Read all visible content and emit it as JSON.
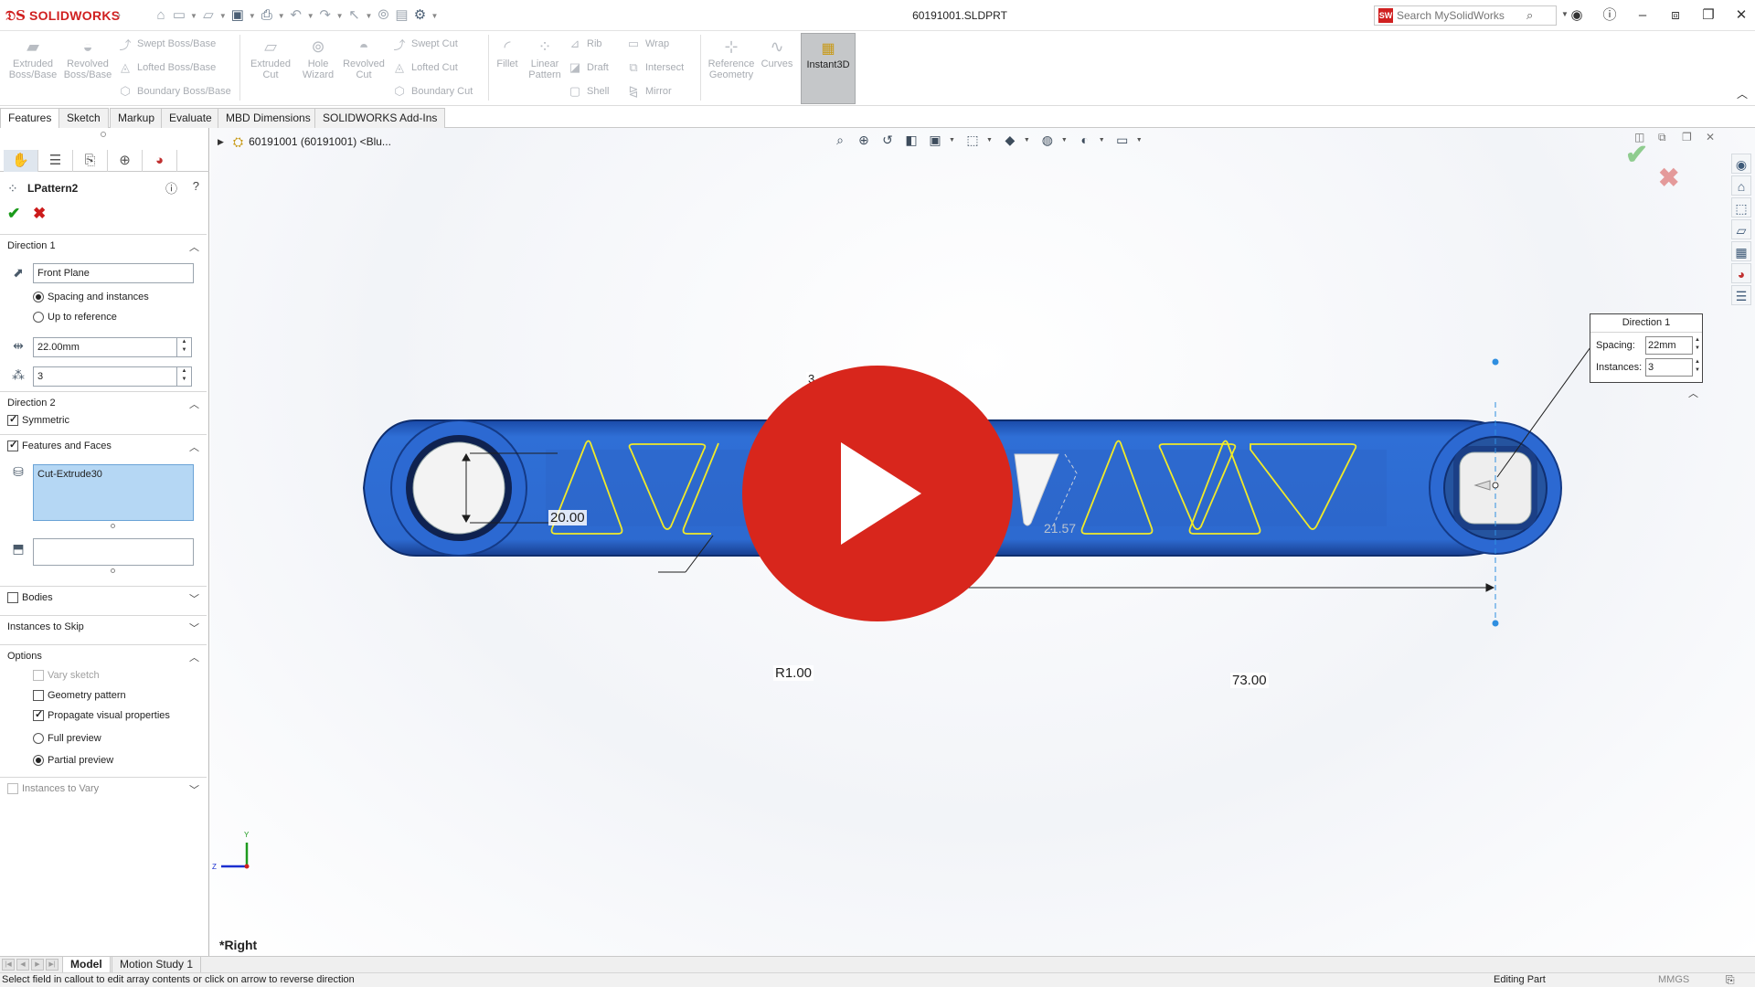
{
  "app": {
    "brand": "SOLIDWORKS",
    "document_title": "60191001.SLDPRT",
    "search_placeholder": "Search MySolidWorks"
  },
  "ribbon": {
    "extruded_cut": "Extruded Cut",
    "extruded_boss": "Extruded Boss/Base",
    "revolved_boss": "Revolved Boss/Base",
    "swept_boss": "Swept Boss/Base",
    "lofted_boss": "Lofted Boss/Base",
    "boundary_boss": "Boundary Boss/Base",
    "hole_wizard": "Hole Wizard",
    "revolved_cut": "Revolved Cut",
    "swept_cut": "Swept Cut",
    "lofted_cut": "Lofted Cut",
    "boundary_cut": "Boundary Cut",
    "fillet": "Fillet",
    "linear_pattern": "Linear Pattern",
    "rib": "Rib",
    "draft": "Draft",
    "shell": "Shell",
    "wrap": "Wrap",
    "intersect": "Intersect",
    "mirror": "Mirror",
    "reference_geometry": "Reference Geometry",
    "curves": "Curves",
    "instant3d": "Instant3D"
  },
  "tabs": [
    "Features",
    "Sketch",
    "Markup",
    "Evaluate",
    "MBD Dimensions",
    "SOLIDWORKS Add-Ins"
  ],
  "property_manager": {
    "title": "LPattern2",
    "direction1": {
      "header": "Direction 1",
      "reference": "Front Plane",
      "opt_spacing": "Spacing and instances",
      "opt_up_to": "Up to reference",
      "spacing": "22.00mm",
      "instances": "3"
    },
    "direction2": {
      "header": "Direction 2",
      "symmetric": "Symmetric"
    },
    "features_faces": {
      "header": "Features and Faces",
      "item": "Cut-Extrude30"
    },
    "bodies": "Bodies",
    "instances_to_skip": "Instances to Skip",
    "options": {
      "header": "Options",
      "vary_sketch": "Vary sketch",
      "geometry_pattern": "Geometry pattern",
      "propagate": "Propagate visual properties",
      "full_preview": "Full preview",
      "partial_preview": "Partial preview"
    },
    "instances_to_vary": "Instances to Vary"
  },
  "tree_flyout": {
    "label": "60191001 (60191001) <Blu..."
  },
  "callout": {
    "title": "Direction 1",
    "spacing_label": "Spacing:",
    "spacing_value": "22mm",
    "instances_label": "Instances:",
    "instances_value": "3"
  },
  "dimensions": {
    "height": "20.00",
    "radius": "R1.00",
    "distance": "73.00",
    "angle_ghost": "21.57",
    "partial": "3"
  },
  "view_name": "*Right",
  "bottom_tabs": [
    "Model",
    "Motion Study 1"
  ],
  "status": {
    "message": "Select field in callout to edit array contents or click on arrow to reverse direction",
    "mode": "Editing Part",
    "units": "MMGS"
  },
  "colors": {
    "part_blue": "#2f6fd6",
    "sketch_yellow": "#f1ea28",
    "play_red": "#d8261c",
    "brand_red": "#d02020"
  }
}
